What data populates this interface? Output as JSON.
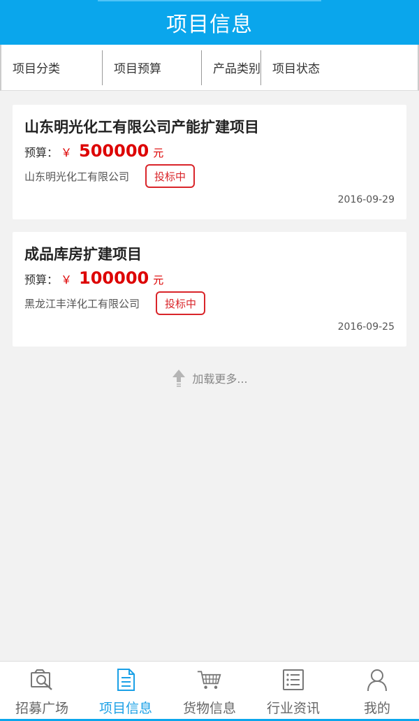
{
  "header": {
    "title": "项目信息"
  },
  "filters": [
    "项目分类",
    "项目预算",
    "产品类别",
    "项目状态"
  ],
  "projects": [
    {
      "title": "山东明光化工有限公司产能扩建项目",
      "budget_label": "预算：",
      "currency": "￥",
      "amount": "500000",
      "unit": "元",
      "company": "山东明光化工有限公司",
      "status": "投标中",
      "date": "2016-09-29"
    },
    {
      "title": "成品库房扩建项目",
      "budget_label": "预算：",
      "currency": "￥",
      "amount": "100000",
      "unit": "元",
      "company": "黑龙江丰洋化工有限公司",
      "status": "投标中",
      "date": "2016-09-25"
    }
  ],
  "load_more": "加载更多...",
  "tabs": [
    {
      "label": "招募广场",
      "icon": "photo-search-icon"
    },
    {
      "label": "项目信息",
      "icon": "document-icon",
      "active": true
    },
    {
      "label": "货物信息",
      "icon": "cart-icon"
    },
    {
      "label": "行业资讯",
      "icon": "list-icon"
    },
    {
      "label": "我的",
      "icon": "person-icon"
    }
  ],
  "colors": {
    "primary": "#0aa6ec",
    "price": "#dd0000",
    "status": "#d9252a",
    "active_tab": "#1aa0e6"
  }
}
